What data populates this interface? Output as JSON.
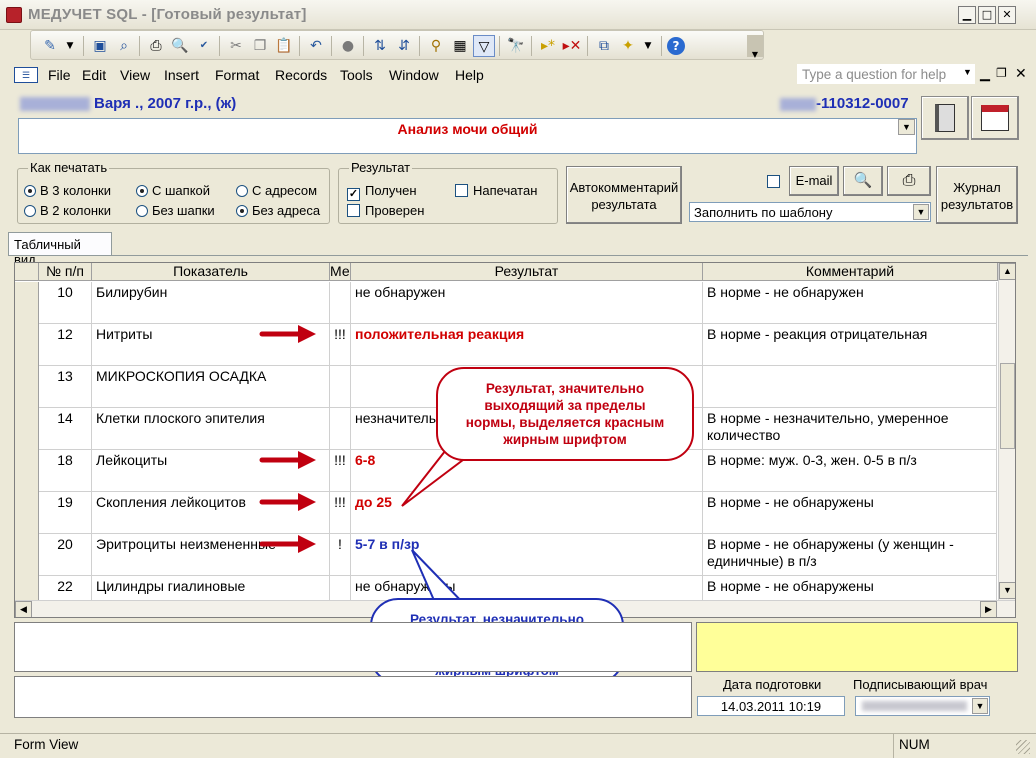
{
  "window": {
    "title": "МЕДУЧЕТ SQL - [Готовый результат]"
  },
  "menu": {
    "items": [
      "File",
      "Edit",
      "View",
      "Insert",
      "Format",
      "Records",
      "Tools",
      "Window",
      "Help"
    ],
    "help_placeholder": "Type a question for help"
  },
  "header": {
    "patient": "Варя ., 2007 г.р., (ж)",
    "code": "-110312-0007",
    "analysis": "Анализ мочи общий"
  },
  "print_options": {
    "legend": "Как печатать",
    "columns3": "В 3 колонки",
    "columns2": "В 2 колонки",
    "with_header": "С шапкой",
    "no_header": "Без шапки",
    "with_address": "С адресом",
    "no_address": "Без адреса"
  },
  "result_status": {
    "legend": "Результат",
    "received": "Получен",
    "checked": "Проверен",
    "printed": "Напечатан"
  },
  "buttons": {
    "autocomment": "Автокомментарий результата",
    "email": "E-mail",
    "template": "Заполнить по шаблону",
    "journal": "Журнал результатов"
  },
  "tab": {
    "label": "Табличный вид"
  },
  "table": {
    "columns": [
      "№ п/п",
      "Показатель",
      "Ме",
      "Результат",
      "Комментарий"
    ],
    "rows": [
      {
        "num": "10",
        "name": "Билирубин",
        "mark": "",
        "result": "не обнаружен",
        "style": "",
        "comment": "В норме - не обнаружен"
      },
      {
        "num": "12",
        "name": "Нитриты",
        "mark": "!!!",
        "result": "положительная реакция",
        "style": "red",
        "comment": "В норме -  реакция отрицательная"
      },
      {
        "num": "13",
        "name": "МИКРОСКОПИЯ ОСАДКА",
        "mark": "",
        "result": "",
        "style": "",
        "comment": ""
      },
      {
        "num": "14",
        "name": "Клетки плоского эпителия",
        "mark": "",
        "result": "незначительное",
        "style": "",
        "comment": "В норме - незначительно, умеренное количество"
      },
      {
        "num": "18",
        "name": "Лейкоциты",
        "mark": "!!!",
        "result": "6-8",
        "style": "red",
        "comment": "В норме: муж.  0-3,  жен.  0-5 в п/з"
      },
      {
        "num": "19",
        "name": "Скопления лейкоцитов",
        "mark": "!!!",
        "result": "до 25",
        "style": "red",
        "comment": "В норме - не обнаружены"
      },
      {
        "num": "20",
        "name": "Эритроциты неизмененные",
        "mark": "!",
        "result": "5-7 в п/зр",
        "style": "blue",
        "comment": "В норме - не обнаружены (у женщин - единичные) в п/з"
      },
      {
        "num": "22",
        "name": "Цилиндры гиалиновые",
        "mark": "",
        "result": "не обнаружены",
        "style": "",
        "comment": "В норме - не обнаружены"
      }
    ]
  },
  "callouts": {
    "red": "Результат, значительно выходящий за пределы нормы, выделяется красным жирным шрифтом",
    "blue": "Результат, незначительно выходящий за пределы нормы, выделяется синим жирным шрифтом"
  },
  "footer": {
    "prep_date_label": "Дата подготовки",
    "prep_date": "14.03.2011 10:19",
    "doctor_label": "Подписывающий врач"
  },
  "status": {
    "left": "Form View",
    "right": "NUM"
  },
  "colors": {
    "red_result": "#d10000",
    "blue_result": "#1f2fb5",
    "note_yellow": "#ffff99"
  }
}
